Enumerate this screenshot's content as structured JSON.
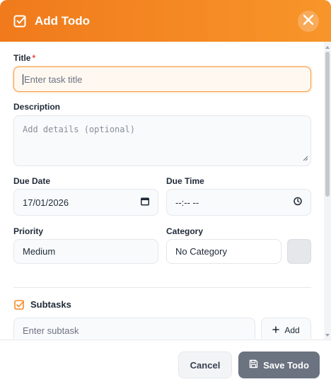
{
  "header": {
    "title": "Add Todo",
    "icon": "checkbox-edit-icon",
    "close_icon": "close-icon",
    "accent": "#f58a24"
  },
  "form": {
    "title": {
      "label": "Title",
      "required_mark": "*",
      "placeholder": "Enter task title",
      "value": ""
    },
    "description": {
      "label": "Description",
      "placeholder": "Add details (optional)",
      "value": ""
    },
    "due_date": {
      "label": "Due Date",
      "value": "17/01/2026",
      "icon": "calendar-icon"
    },
    "due_time": {
      "label": "Due Time",
      "value": "--:-- --",
      "icon": "clock-icon"
    },
    "priority": {
      "label": "Priority",
      "value": "Medium"
    },
    "category": {
      "label": "Category",
      "value": "No Category",
      "color": "#e5e7eb"
    },
    "subtasks": {
      "title": "Subtasks",
      "icon": "checkbox-icon",
      "placeholder": "Enter subtask",
      "add_label": "Add",
      "add_icon": "plus-icon"
    }
  },
  "footer": {
    "cancel_label": "Cancel",
    "save_label": "Save Todo",
    "save_icon": "save-icon",
    "save_color": "#6b7280"
  }
}
